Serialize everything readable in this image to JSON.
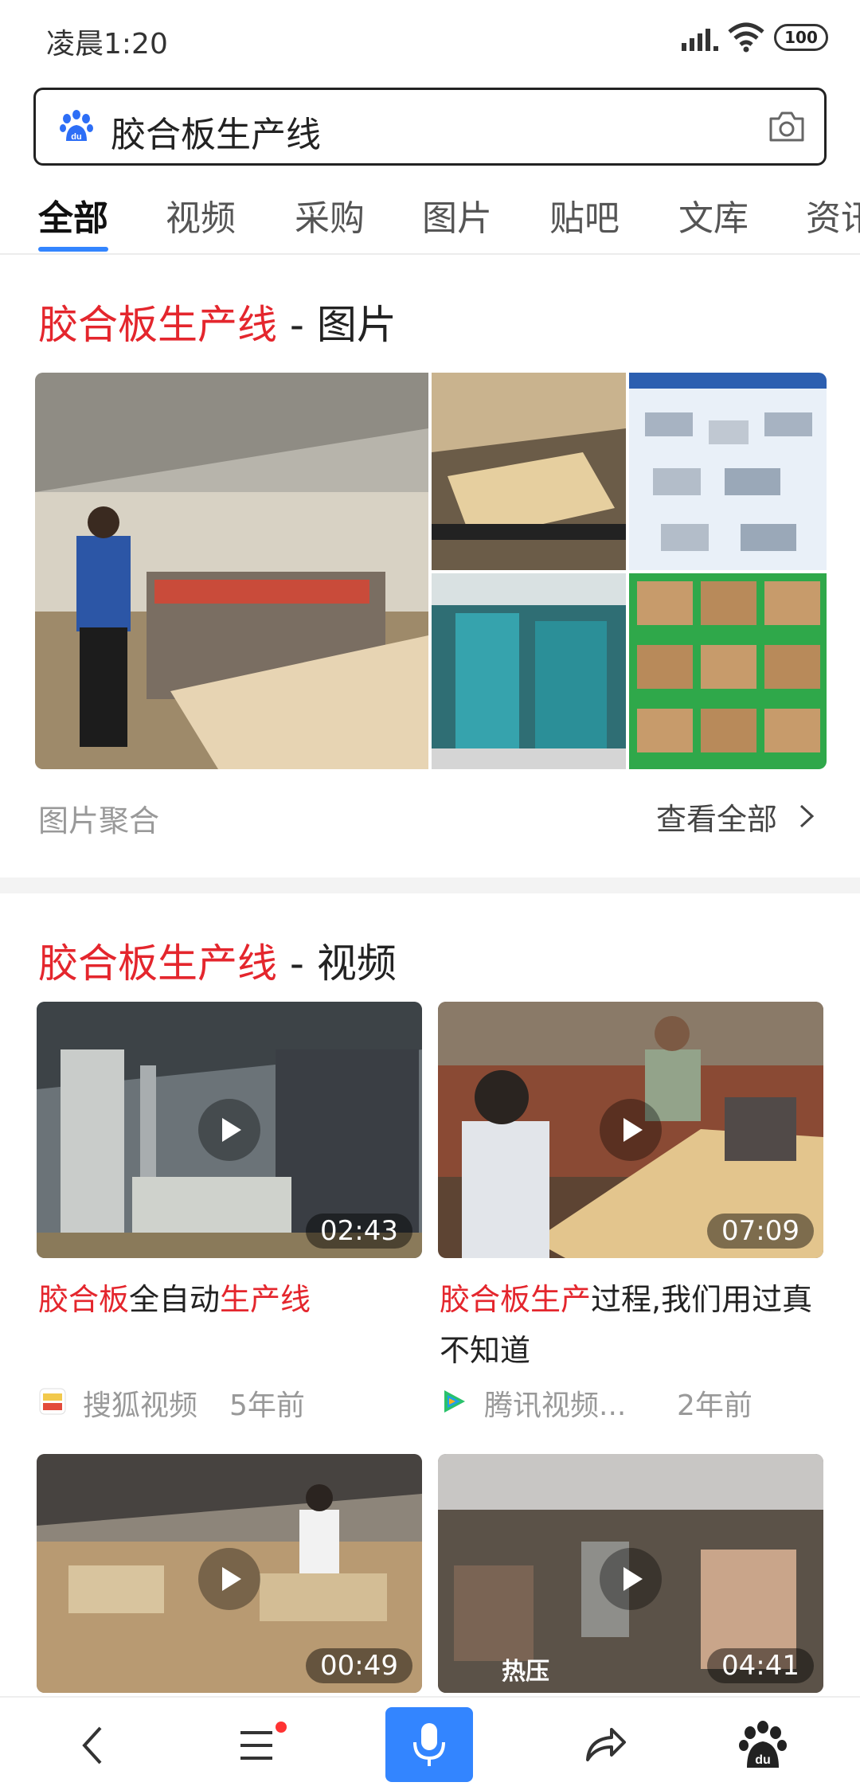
{
  "status_bar": {
    "time": "凌晨1:20",
    "battery": "100"
  },
  "search": {
    "query": "胶合板生产线"
  },
  "tabs": [
    "全部",
    "视频",
    "采购",
    "图片",
    "贴吧",
    "文库",
    "资讯"
  ],
  "image_section": {
    "title_highlight": "胶合板生产线",
    "title_rest": " - 图片",
    "aggregate_label": "图片聚合",
    "view_all": "查看全部"
  },
  "video_section": {
    "title_highlight": "胶合板生产线",
    "title_rest": " - 视频",
    "videos": [
      {
        "duration": "02:43",
        "title_parts": [
          "胶合板",
          "全自动",
          "生产线"
        ],
        "source": "搜狐视频",
        "age": "5年前"
      },
      {
        "duration": "07:09",
        "title_parts": [
          "胶合板生产",
          "过程,我们用过真不知道"
        ],
        "source": "腾讯视频...",
        "age": "2年前"
      },
      {
        "duration": "00:49"
      },
      {
        "duration": "04:41",
        "overlay_text": "热压"
      }
    ]
  },
  "colors": {
    "highlight": "#e4262d",
    "accent": "#3385ff"
  }
}
